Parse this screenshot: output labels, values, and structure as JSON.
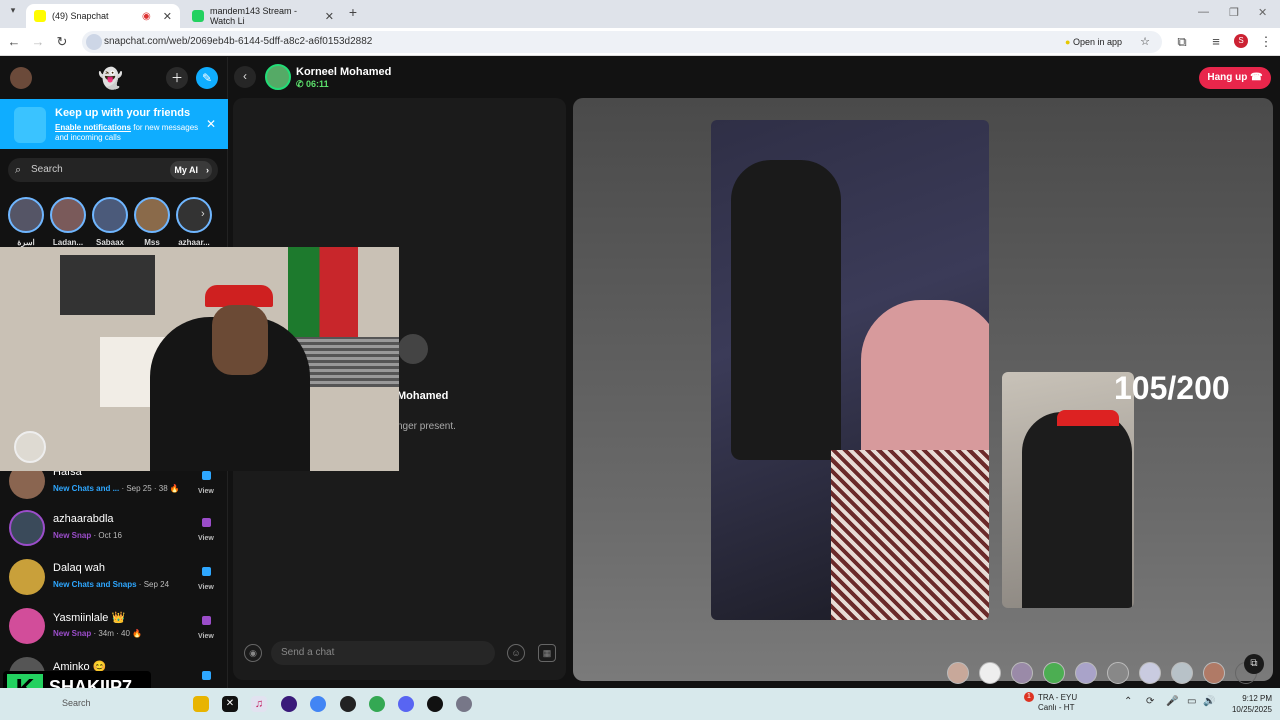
{
  "browser": {
    "tabs": [
      {
        "title": "(49) Snapchat",
        "active": true
      },
      {
        "title": "mandem143 Stream - Watch Li",
        "active": false
      }
    ],
    "url": "snapchat.com/web/2069eb4b-6144-5dff-a8c2-a6f0153d2882",
    "open_in_app": "Open in app",
    "profile_initial": "S"
  },
  "sidebar": {
    "banner": {
      "title": "Keep up with your friends",
      "link": "Enable notifications",
      "rest": " for new messages and incoming calls"
    },
    "search_placeholder": "Search",
    "my_ai": "My AI",
    "stories": [
      "اسرة",
      "Ladan...",
      "Sabaax",
      "Mss",
      "azhaar..."
    ],
    "chats": [
      {
        "name": "Hafsa",
        "status": "New Chats and ...",
        "time": " · Sep 25 · 38 🔥",
        "view": "View",
        "color": "#2ea7ff"
      },
      {
        "name": "azhaarabdla",
        "status": "New Snap",
        "time": " · Oct 16",
        "view": "View",
        "color": "#9b4dca"
      },
      {
        "name": "Dalaq wah",
        "status": "New Chats and Snaps",
        "time": " · Sep 24",
        "view": "View",
        "color": "#2ea7ff"
      },
      {
        "name": "Yasmiinlale 👑",
        "status": "New Snap",
        "time": " · 34m · 40 🔥",
        "view": "View",
        "color": "#9b4dca"
      },
      {
        "name": "Aminko 😊",
        "status": "",
        "time": "",
        "view": "",
        "color": "#2ea7ff"
      }
    ]
  },
  "call": {
    "name": "Korneel Mohamed",
    "timer": "06:11",
    "hangup": "Hang up",
    "chat_name_fragment": "Mohamed",
    "chat_note_fragment": "nger present.",
    "chat_placeholder": "Send a chat"
  },
  "overlay": {
    "counter": "105/200",
    "watermark": "SHAKIIP7",
    "logo_letter": "K"
  },
  "taskbar": {
    "search": "Search",
    "notification_count": "1",
    "weather_line1": "TRA - EYU",
    "weather_line2": "Canlı - HT",
    "time": "9:12 PM",
    "date": "10/25/2025"
  }
}
